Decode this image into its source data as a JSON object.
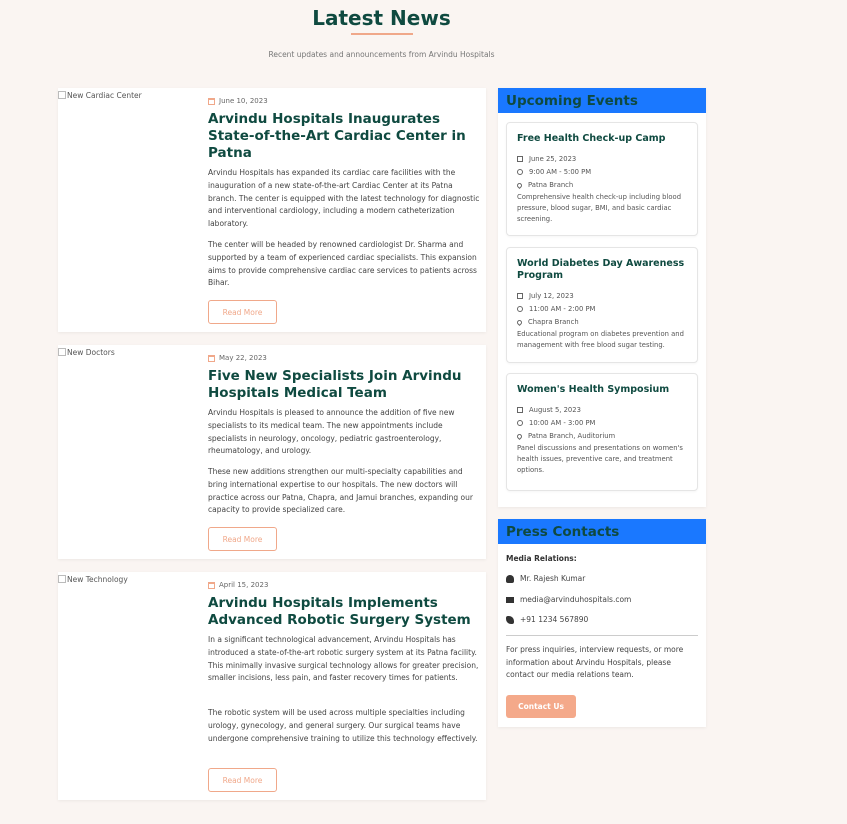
{
  "header": {
    "title": "Latest News",
    "subtitle": "Recent updates and announcements from Arvindu Hospitals"
  },
  "news": [
    {
      "image_alt": "New Cardiac Center",
      "date": "June 10, 2023",
      "title": "Arvindu Hospitals Inaugurates State-of-the-Art Cardiac Center in Patna",
      "para1": "Arvindu Hospitals has expanded its cardiac care facilities with the inauguration of a new state-of-the-art Cardiac Center at its Patna branch. The center is equipped with the latest technology for diagnostic and interventional cardiology, including a modern catheterization laboratory.",
      "para2": "The center will be headed by renowned cardiologist Dr. Sharma and supported by a team of experienced cardiac specialists. This expansion aims to provide comprehensive cardiac care services to patients across Bihar.",
      "read_more": "Read More"
    },
    {
      "image_alt": "New Doctors",
      "date": "May 22, 2023",
      "title": "Five New Specialists Join Arvindu Hospitals Medical Team",
      "para1": "Arvindu Hospitals is pleased to announce the addition of five new specialists to its medical team. The new appointments include specialists in neurology, oncology, pediatric gastroenterology, rheumatology, and urology.",
      "para2": "These new additions strengthen our multi-specialty capabilities and bring international expertise to our hospitals. The new doctors will practice across our Patna, Chapra, and Jamui branches, expanding our capacity to provide specialized care.",
      "read_more": "Read More"
    },
    {
      "image_alt": "New Technology",
      "date": "April 15, 2023",
      "title": "Arvindu Hospitals Implements Advanced Robotic Surgery System",
      "para1": "In a significant technological advancement, Arvindu Hospitals has introduced a state-of-the-art robotic surgery system at its Patna facility. This minimally invasive surgical technology allows for greater precision, smaller incisions, less pain, and faster recovery times for patients.",
      "para2": "The robotic system will be used across multiple specialties including urology, gynecology, and general surgery. Our surgical teams have undergone comprehensive training to utilize this technology effectively.",
      "read_more": "Read More"
    }
  ],
  "events": {
    "heading": "Upcoming Events",
    "items": [
      {
        "title": "Free Health Check-up Camp",
        "date": "June 25, 2023",
        "time": "9:00 AM - 5:00 PM",
        "location": "Patna Branch",
        "desc": "Comprehensive health check-up including blood pressure, blood sugar, BMI, and basic cardiac screening."
      },
      {
        "title": "World Diabetes Day Awareness Program",
        "date": "July 12, 2023",
        "time": "11:00 AM - 2:00 PM",
        "location": "Chapra Branch",
        "desc": "Educational program on diabetes prevention and management with free blood sugar testing."
      },
      {
        "title": "Women's Health Symposium",
        "date": "August 5, 2023",
        "time": "10:00 AM - 3:00 PM",
        "location": "Patna Branch, Auditorium",
        "desc": "Panel discussions and presentations on women's health issues, preventive care, and treatment options."
      }
    ]
  },
  "press": {
    "heading": "Press Contacts",
    "label": "Media Relations:",
    "name": "Mr. Rajesh Kumar",
    "email": "media@arvinduhospitals.com",
    "phone": "+91 1234 567890",
    "note": "For press inquiries, interview requests, or more information about Arvindu Hospitals, please contact our media relations team.",
    "button": "Contact Us"
  },
  "colors": {
    "accent": "#f0a88a",
    "heading": "#0f4a40",
    "panel_head": "#1a78ff",
    "background": "#faf5f2"
  }
}
